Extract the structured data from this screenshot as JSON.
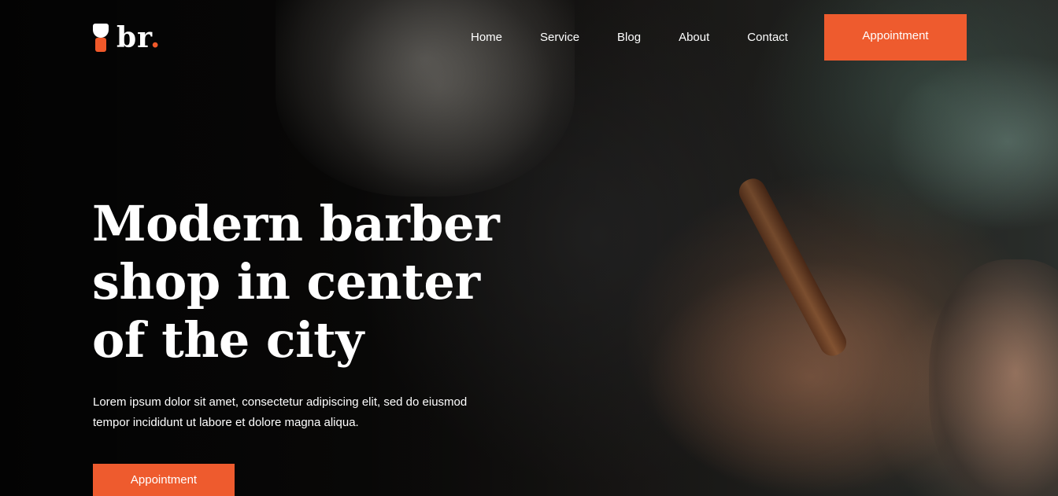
{
  "logo": {
    "text": "br",
    "dot": "."
  },
  "nav": {
    "items": [
      {
        "label": "Home"
      },
      {
        "label": "Service"
      },
      {
        "label": "Blog"
      },
      {
        "label": "About"
      },
      {
        "label": "Contact"
      }
    ],
    "cta_label": "Appointment"
  },
  "hero": {
    "headline_lines": [
      "Modern barber",
      "shop in center",
      "of the city"
    ],
    "subtext_lines": [
      "Lorem ipsum dolor sit amet, consectetur adipiscing elit, sed do eiusmod",
      "tempor incididunt ut labore et dolore magna aliqua."
    ],
    "cta_label": "Appointment"
  },
  "colors": {
    "accent": "#ee5b2e",
    "text": "#ffffff"
  },
  "icons": {
    "logo_icon": "shaving-brush-icon"
  }
}
